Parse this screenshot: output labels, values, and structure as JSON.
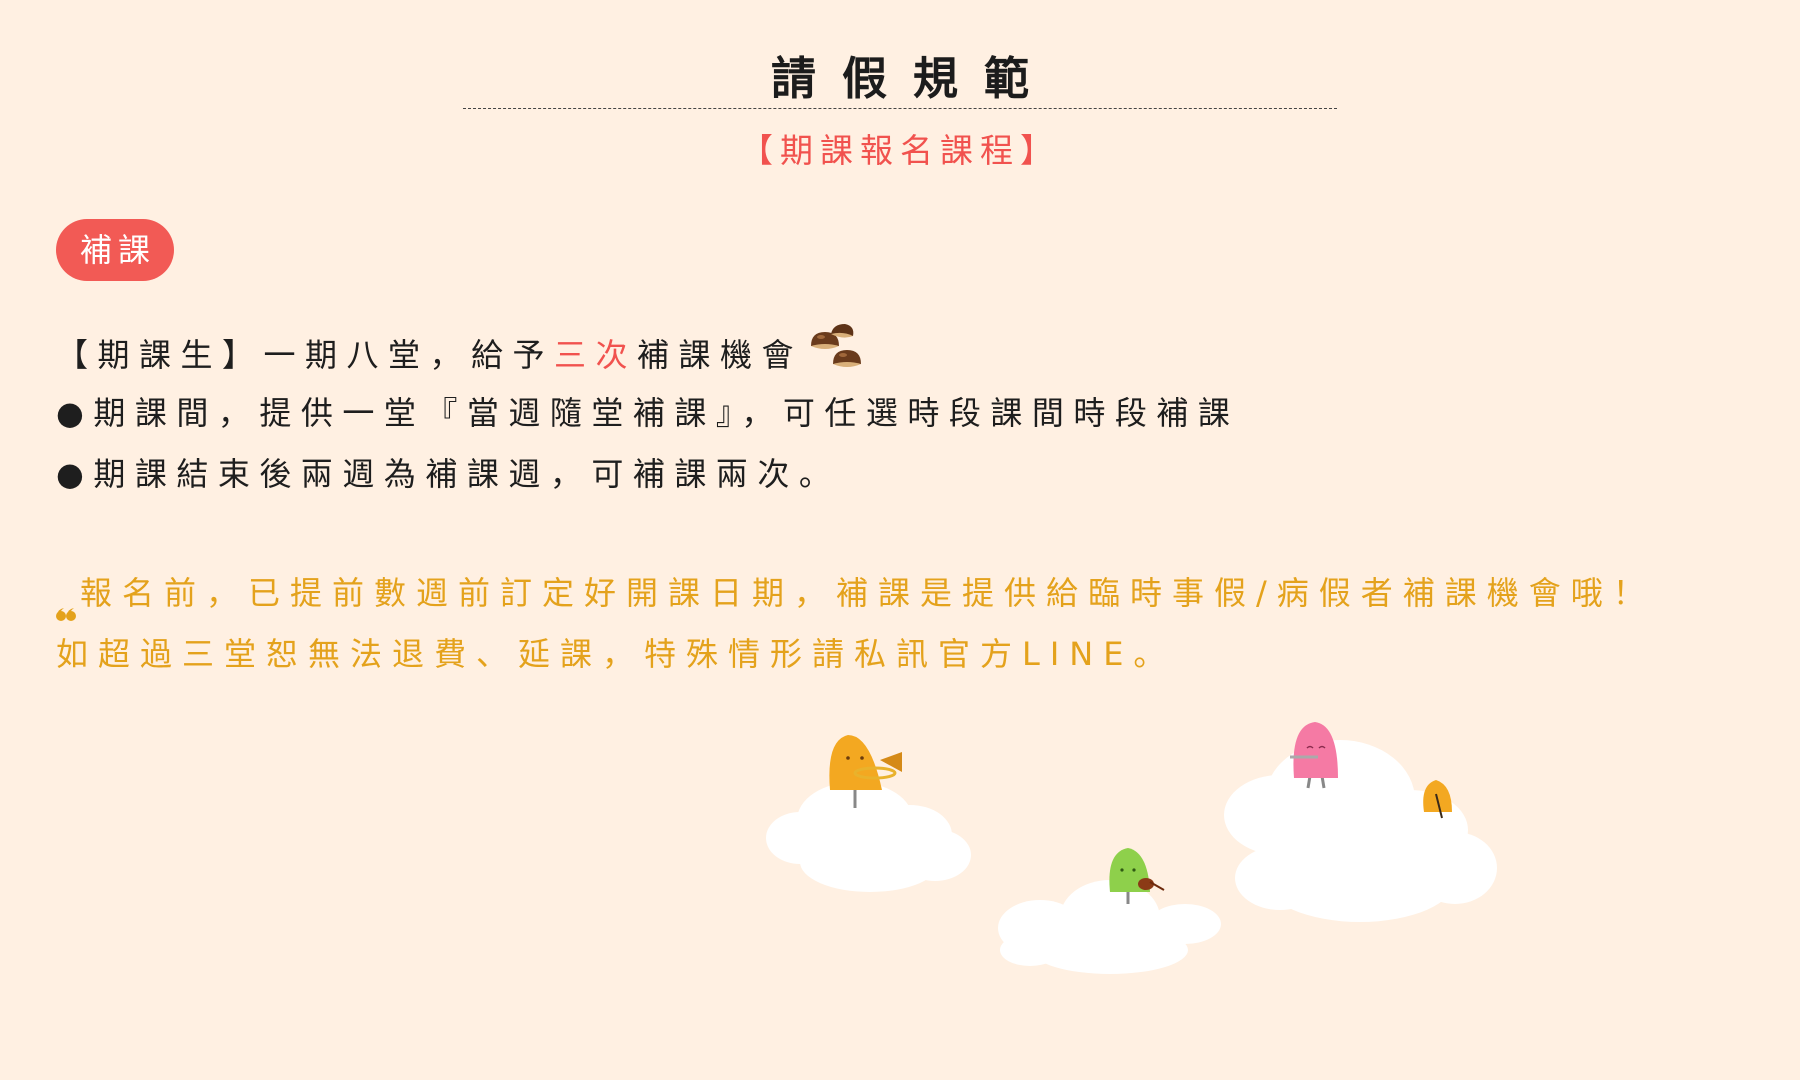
{
  "header": {
    "title": "請假規範",
    "subtitle": "【期課報名課程】"
  },
  "tag": {
    "label": "補課"
  },
  "rules": {
    "line1_prefix": "【期課生】一期八堂，給予",
    "line1_highlight": "三次",
    "line1_suffix": "補課機會",
    "line2": "●期課間，提供一堂『當週隨堂補課』，可任選時段課間時段補課",
    "line3": "●期課結束後兩週為補課週，可補課兩次。"
  },
  "note": {
    "line1": "報名前，已提前數週前訂定好開課日期，補課是提供給臨時事假/病假者補課機會哦！",
    "line2": "如超過三堂恕無法退費、延課，特殊情形請私訊官方LINE。"
  },
  "icons": {
    "emoji": "chestnut-icon",
    "quote": "quote-icon"
  },
  "colors": {
    "background": "#fff0e2",
    "accent": "#f1524e",
    "note": "#e4a21c",
    "tag": "#f25a55"
  }
}
